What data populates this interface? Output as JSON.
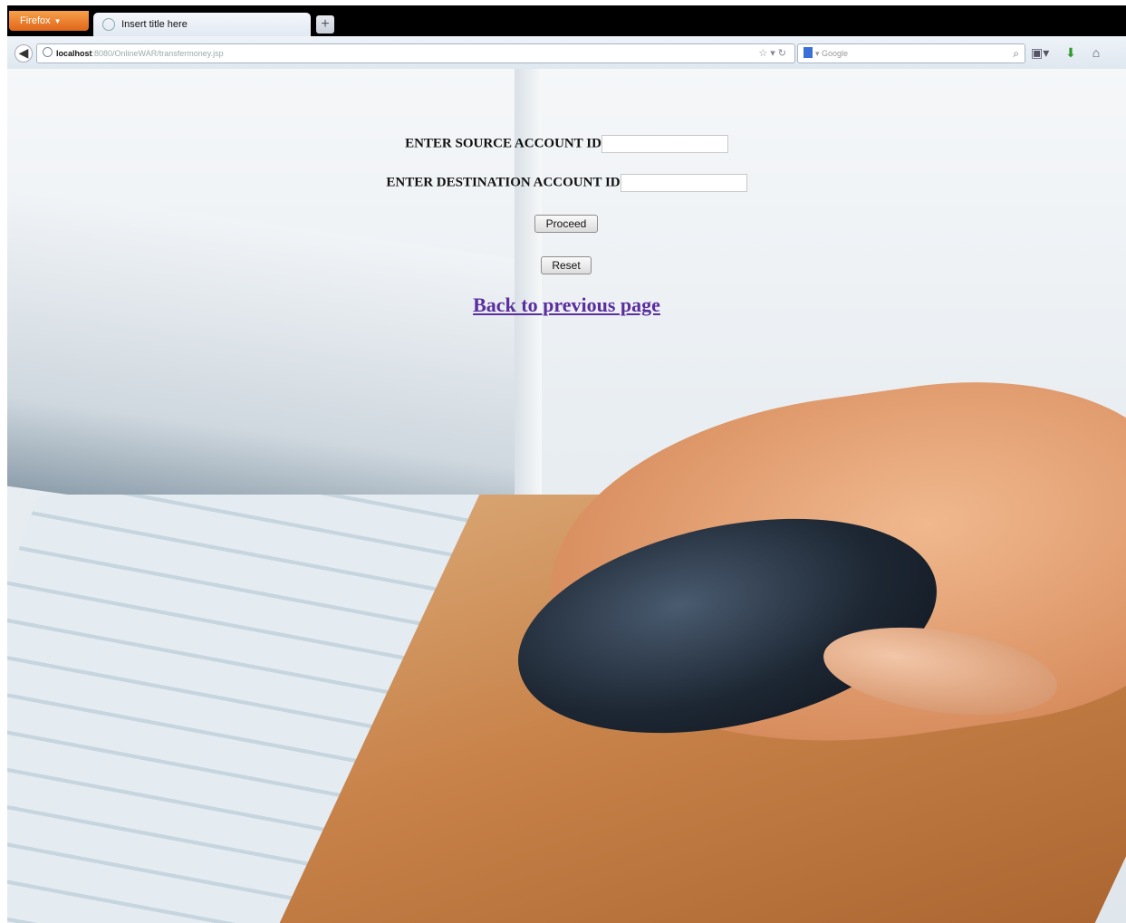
{
  "browser": {
    "menu_button": "Firefox",
    "tab_title": "Insert title here",
    "new_tab": "+",
    "url_host": "localhost",
    "url_path": ":8080/OnlineWAR/transfermoney.jsp",
    "search_placeholder": "Google"
  },
  "form": {
    "source_label": "ENTER SOURCE ACCOUNT ID",
    "source_value": "",
    "destination_label": "ENTER DESTINATION ACCOUNT ID",
    "destination_value": "",
    "proceed_label": "Proceed",
    "reset_label": "Reset",
    "back_link": "Back to previous page"
  },
  "icons": {
    "back": "back-arrow-icon",
    "globe": "globe-icon",
    "star": "bookmark-star-icon",
    "reload": "reload-icon",
    "search_engine": "google-icon",
    "search": "magnifier-icon",
    "sidebar": "sidebar-icon",
    "download": "download-icon",
    "home": "home-icon"
  }
}
